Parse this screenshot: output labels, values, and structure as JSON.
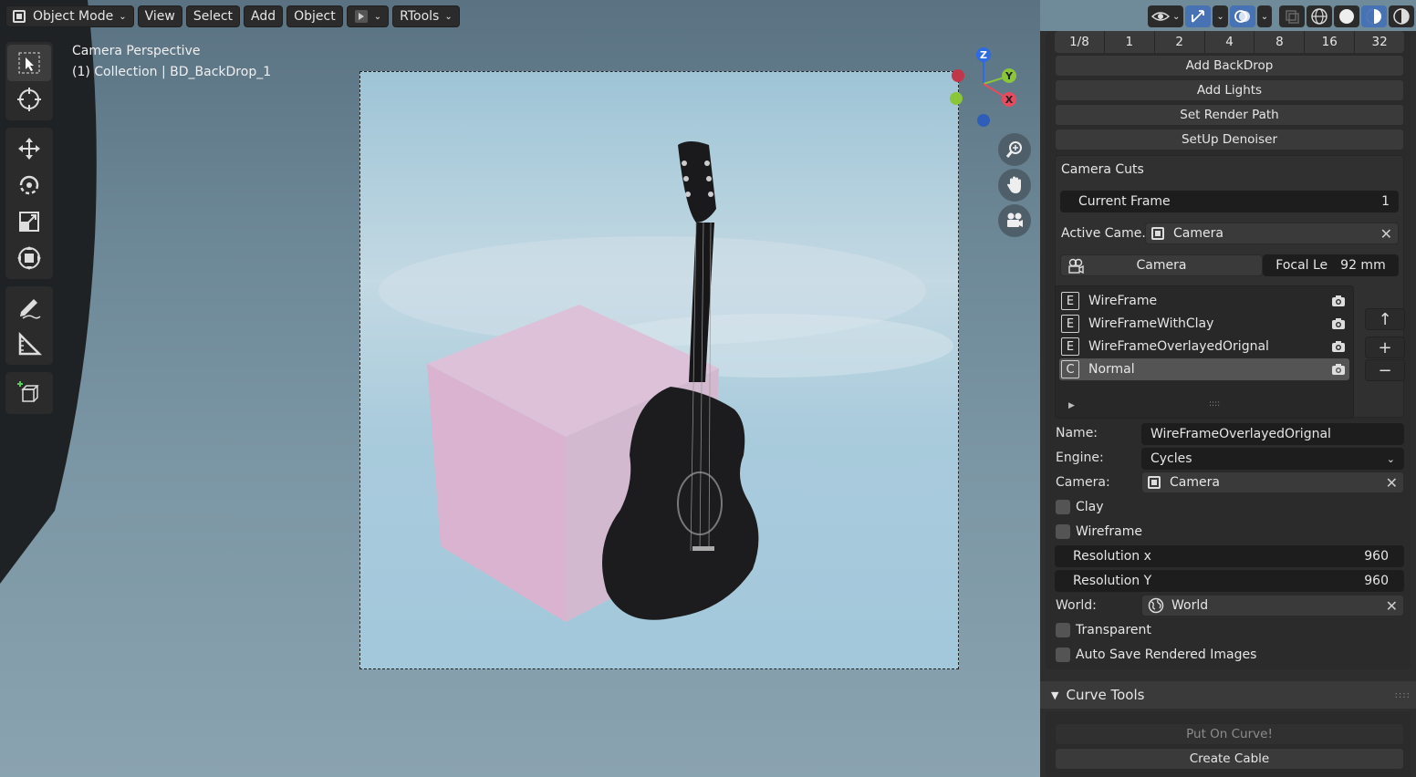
{
  "header": {
    "mode_label": "Object Mode",
    "menus": [
      "View",
      "Select",
      "Add",
      "Object"
    ],
    "addon_menu": "RTools"
  },
  "viewport": {
    "title": "Camera Perspective",
    "subtitle": "(1) Collection | BD_BackDrop_1",
    "gizmo": {
      "x": "X",
      "y": "Y",
      "z": "Z"
    }
  },
  "toolbar": {
    "icons": [
      "select-box-icon",
      "cursor-icon",
      "move-icon",
      "rotate-icon",
      "scale-icon",
      "transform-icon",
      "annotate-icon",
      "measure-icon",
      "add-cube-icon"
    ]
  },
  "sidebar": {
    "resolution_divs": [
      "1/8",
      "1",
      "2",
      "4",
      "8",
      "16",
      "32"
    ],
    "buttons": {
      "add_backdrop": "Add BackDrop",
      "add_lights": "Add Lights",
      "set_render_path": "Set Render Path",
      "setup_denoiser": "SetUp Denoiser"
    },
    "camera_cuts": {
      "title": "Camera Cuts",
      "current_frame_label": "Current Frame",
      "current_frame_value": "1",
      "active_camera_label": "Active Came...",
      "active_camera_value": "Camera",
      "camera_button": "Camera",
      "focal_label": "Focal Le",
      "focal_value": "92 mm"
    },
    "render_list": [
      {
        "badge": "E",
        "name": "WireFrame"
      },
      {
        "badge": "E",
        "name": "WireFrameWithClay"
      },
      {
        "badge": "E",
        "name": "WireFrameOverlayedOrignal"
      },
      {
        "badge": "C",
        "name": "Normal"
      }
    ],
    "props": {
      "name_label": "Name:",
      "name_value": "WireFrameOverlayedOrignal",
      "engine_label": "Engine:",
      "engine_value": "Cycles",
      "camera_label": "Camera:",
      "camera_value": "Camera",
      "clay_label": "Clay",
      "wireframe_label": "Wireframe",
      "resx_label": "Resolution x",
      "resx_value": "960",
      "resy_label": "Resolution Y",
      "resy_value": "960",
      "world_label": "World:",
      "world_value": "World",
      "transparent_label": "Transparent",
      "autosave_label": "Auto Save Rendered Images"
    },
    "curve_tools": {
      "title": "Curve Tools",
      "put_on_curve": "Put On Curve!",
      "create_cable": "Create Cable"
    }
  }
}
